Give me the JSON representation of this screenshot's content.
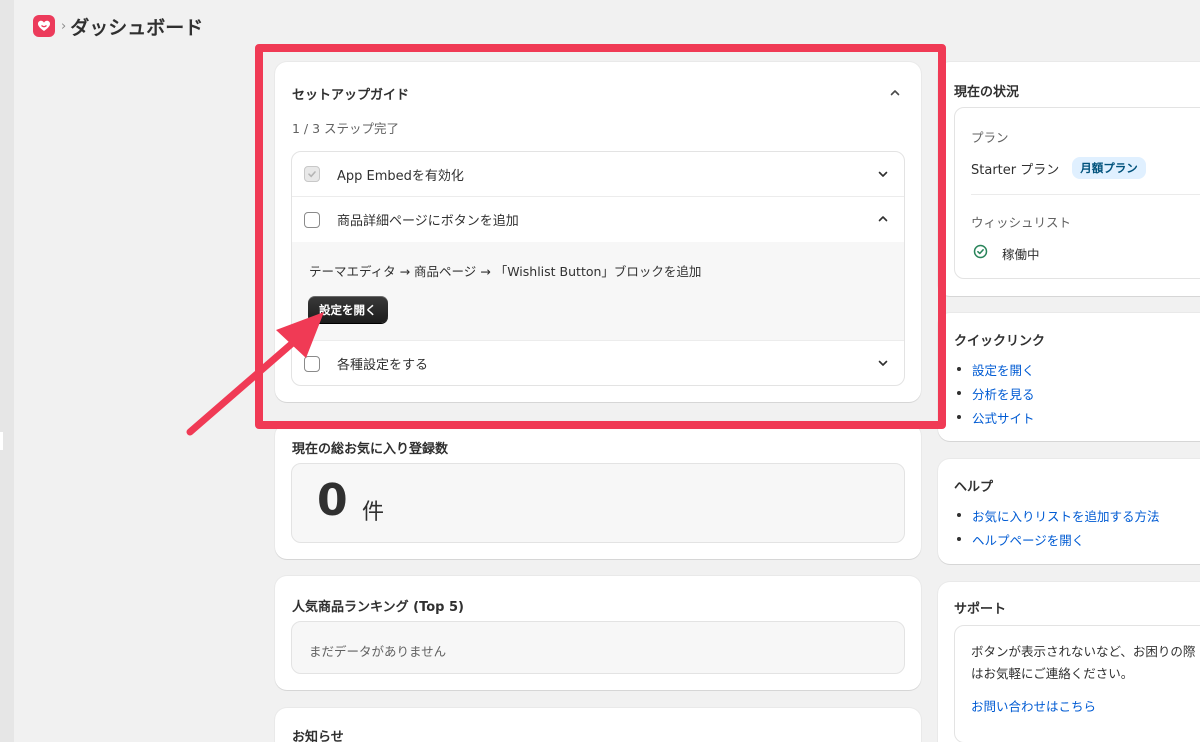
{
  "header": {
    "breadcrumb_separator": "›",
    "title": "ダッシュボード"
  },
  "setup_guide": {
    "title": "セットアップガイド",
    "progress": "1 / 3 ステップ完了",
    "steps": [
      {
        "label": "App Embedを有効化",
        "completed": true,
        "expanded": false
      },
      {
        "label": "商品詳細ページにボタンを追加",
        "completed": false,
        "expanded": true,
        "detail": "テーマエディタ → 商品ページ → 「Wishlist Button」ブロックを追加",
        "button_label": "設定を開く"
      },
      {
        "label": "各種設定をする",
        "completed": false,
        "expanded": false
      }
    ]
  },
  "favorites": {
    "title": "現在の総お気に入り登録数",
    "count": "0",
    "unit": "件"
  },
  "ranking": {
    "title": "人気商品ランキング (Top 5)",
    "empty_text": "まだデータがありません"
  },
  "news": {
    "title": "お知らせ"
  },
  "status": {
    "title": "現在の状況",
    "plan_heading": "プラン",
    "plan_name": "Starter プラン",
    "plan_badge": "月額プラン",
    "wishlist_heading": "ウィッシュリスト",
    "wishlist_status": "稼働中"
  },
  "quick_links": {
    "title": "クイックリンク",
    "items": [
      "設定を開く",
      "分析を見る",
      "公式サイト"
    ]
  },
  "help": {
    "title": "ヘルプ",
    "items": [
      "お気に入りリストを追加する方法",
      "ヘルプページを開く"
    ]
  },
  "support": {
    "title": "サポート",
    "text_line1": "ボタンが表示されないなど、お困りの際",
    "text_line2": "はお気軽にご連絡ください。",
    "link": "お問い合わせはこちら"
  },
  "colors": {
    "annotation": "#f03a55",
    "link": "#005bd3",
    "brand": "#ec3b5b",
    "success": "#29845a"
  }
}
